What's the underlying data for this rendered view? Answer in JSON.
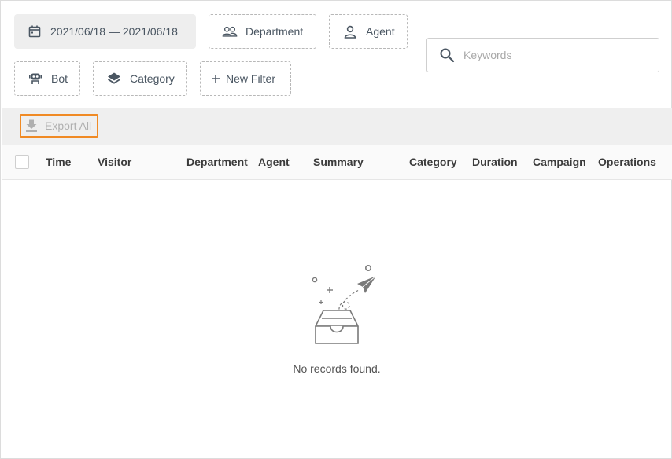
{
  "filters": {
    "date_range": "2021/06/18 — 2021/06/18",
    "department": "Department",
    "agent": "Agent",
    "bot": "Bot",
    "category": "Category",
    "new_filter": "New Filter"
  },
  "search": {
    "placeholder": "Keywords",
    "value": ""
  },
  "toolbar": {
    "export_label": "Export All"
  },
  "table": {
    "columns": [
      "Time",
      "Visitor",
      "Department",
      "Agent",
      "Summary",
      "Category",
      "Duration",
      "Campaign",
      "Operations"
    ],
    "rows": []
  },
  "empty_state": {
    "message": "No records found."
  },
  "colors": {
    "accent_outline": "#f08a24",
    "icon": "#4a5662"
  },
  "icons": [
    "calendar-icon",
    "team-icon",
    "person-icon",
    "robot-icon",
    "layers-icon",
    "plus-icon",
    "search-icon",
    "download-icon",
    "empty-inbox-icon"
  ]
}
